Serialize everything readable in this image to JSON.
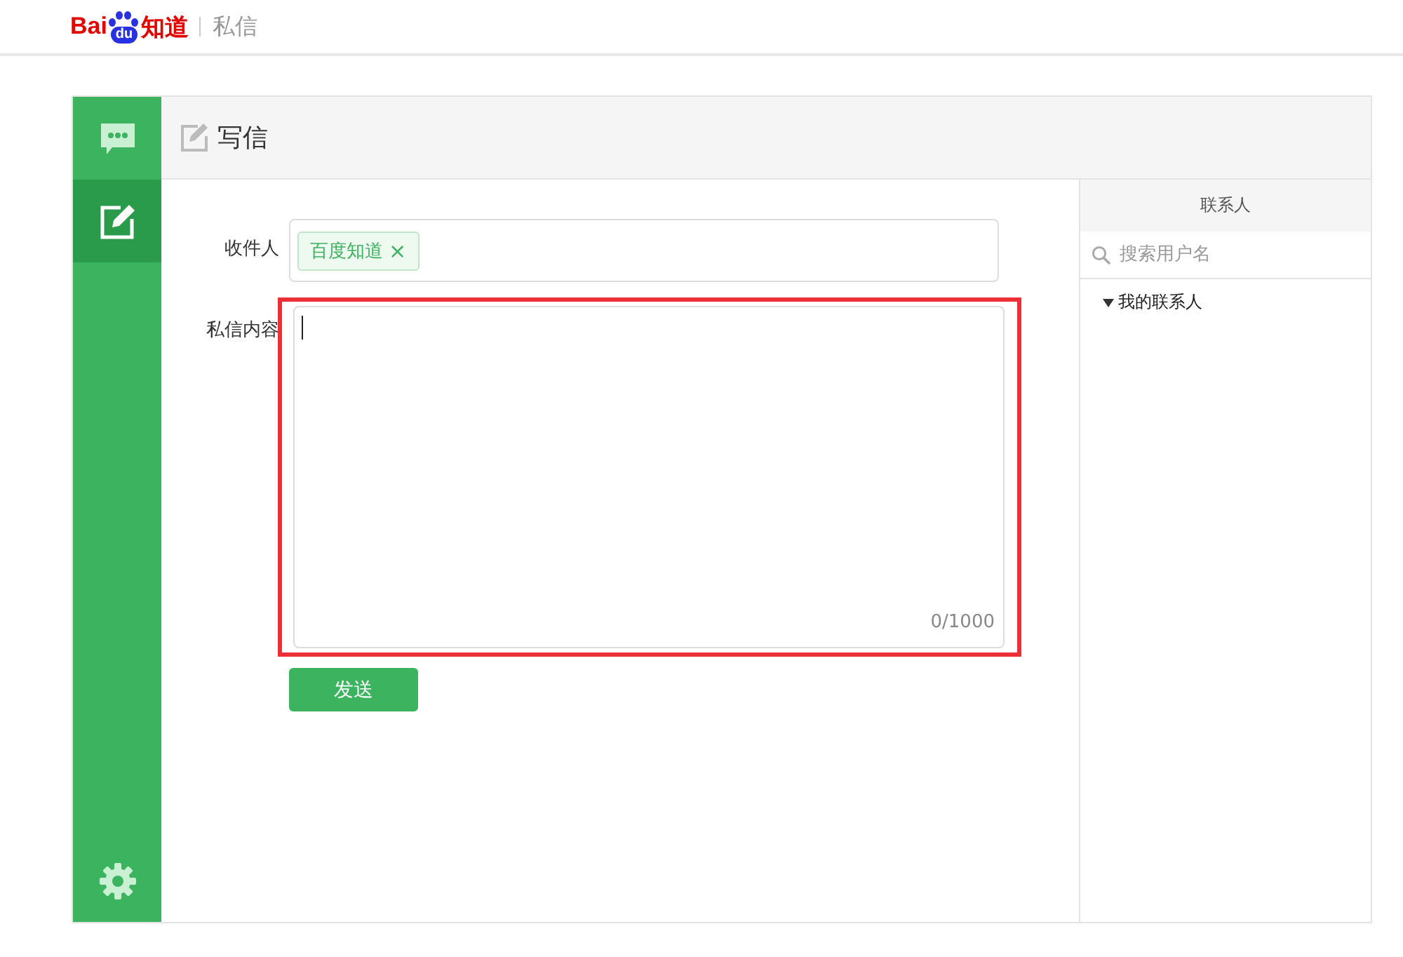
{
  "header": {
    "logo": {
      "left": "Bai",
      "paw": "du",
      "right": "知道"
    },
    "section": "私信"
  },
  "sidebar": {
    "items": [
      {
        "kind": "messages",
        "selected": false
      },
      {
        "kind": "compose",
        "selected": true
      },
      {
        "kind": "settings",
        "selected": false
      }
    ]
  },
  "panel": {
    "title": "写信"
  },
  "form": {
    "recipient_label": "收件人",
    "recipients": [
      {
        "name": "百度知道",
        "remove": "×"
      }
    ],
    "message_label": "私信内容",
    "message": {
      "counter": "0/1000",
      "highlighted": true,
      "focused": true
    },
    "send_button": "发送"
  },
  "contacts": {
    "title": "联系人",
    "search": {
      "placeholder": "搜索用户名"
    },
    "groups": [
      {
        "name": "我的联系人",
        "expanded": true
      }
    ]
  }
}
